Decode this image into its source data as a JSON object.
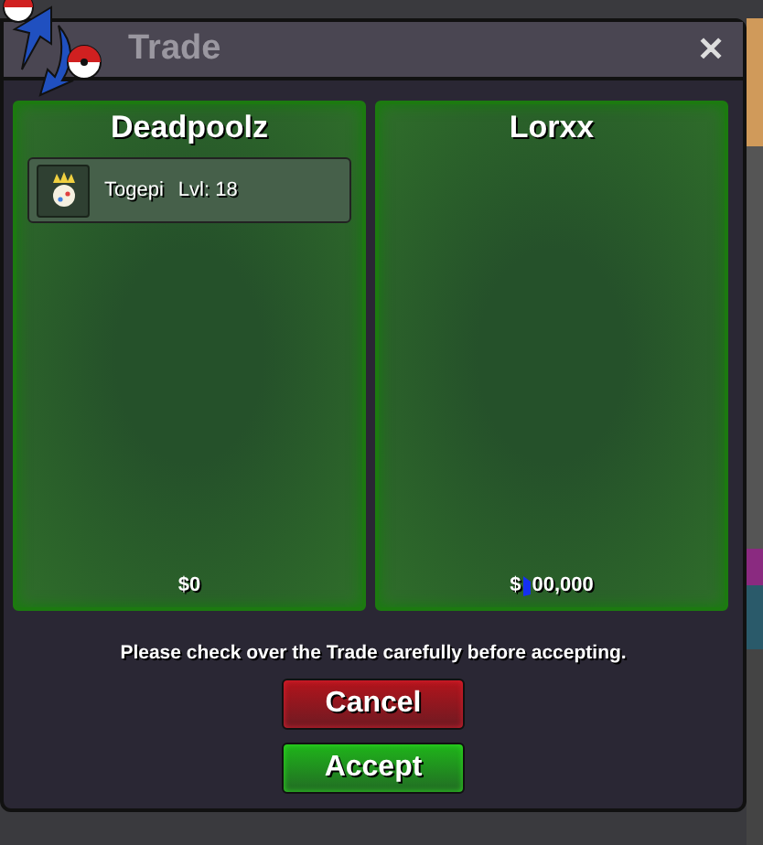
{
  "window": {
    "title": "Trade",
    "close": "✕"
  },
  "panels": [
    {
      "player": "Deadpoolz",
      "items": [
        {
          "name": "Togepi",
          "level": "Lvl: 18"
        }
      ],
      "money": [
        {
          "text": "$0"
        }
      ]
    },
    {
      "player": "Lorxx",
      "money": [
        {
          "text": "$"
        },
        {
          "text": "00,000"
        }
      ],
      "cursor_over_money": true
    }
  ],
  "message": "Please check over the Trade carefully before accepting.",
  "buttons": [
    {
      "label": "Cancel",
      "kind": "cancel"
    },
    {
      "label": "Accept",
      "kind": "accept"
    }
  ]
}
